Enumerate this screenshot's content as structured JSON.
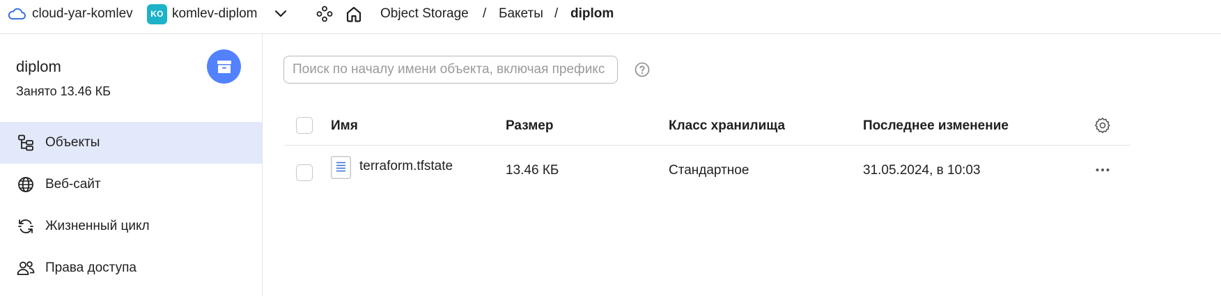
{
  "topbar": {
    "cloud_name": "cloud-yar-komlev",
    "folder_avatar": "KO",
    "folder_name": "komlev-diplom",
    "breadcrumbs": [
      "Object Storage",
      "Бакеты",
      "diplom"
    ],
    "separator": "/",
    "icons": [
      "cloud-icon",
      "chevron-down-icon",
      "services-icon",
      "home-icon"
    ]
  },
  "sidebar": {
    "bucket_name": "diplom",
    "bucket_used": "Занято 13.46 КБ",
    "items": [
      {
        "label": "Объекты",
        "icon": "objects-tree-icon",
        "active": true
      },
      {
        "label": "Веб-сайт",
        "icon": "globe-icon",
        "active": false
      },
      {
        "label": "Жизненный цикл",
        "icon": "lifecycle-icon",
        "active": false
      },
      {
        "label": "Права доступа",
        "icon": "users-icon",
        "active": false
      }
    ]
  },
  "main": {
    "search": {
      "placeholder": "Поиск по началу имени объекта, включая префикс",
      "value": ""
    },
    "table": {
      "columns": [
        "Имя",
        "Размер",
        "Класс хранилища",
        "Последнее изменение"
      ],
      "rows": [
        {
          "name": "terraform.tfstate",
          "size": "13.46 КБ",
          "storage_class": "Стандартное",
          "modified": "31.05.2024, в 10:03"
        }
      ]
    }
  },
  "colors": {
    "accent": "#5282ff",
    "folder_avatar_bg": "#1cb3c8",
    "active_nav_bg": "#e2e9fb",
    "border": "#e4e4e4"
  }
}
